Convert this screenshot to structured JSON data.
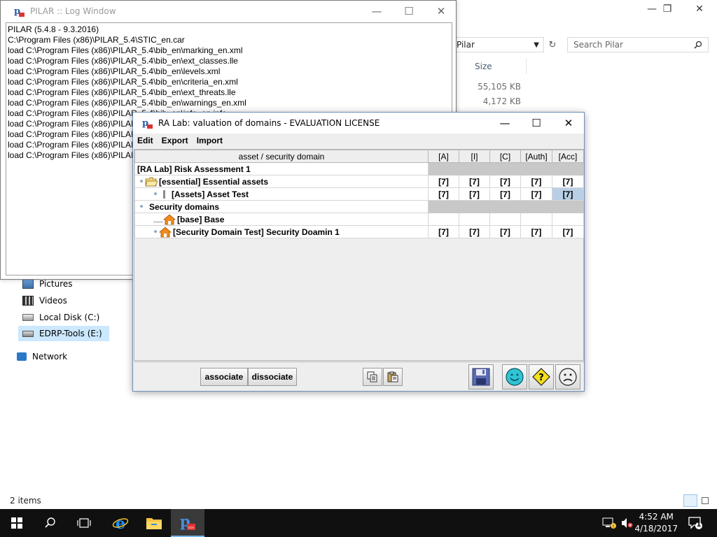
{
  "explorer": {
    "address_text": "Pilar",
    "search_placeholder": "Search Pilar",
    "column_size": "Size",
    "file_sizes": [
      "55,105 KB",
      "4,172 KB"
    ],
    "nav_items": [
      "Pictures",
      "Videos",
      "Local Disk (C:)",
      "EDRP-Tools (E:)",
      "Network"
    ],
    "status": "2 items"
  },
  "log_window": {
    "title": "PILAR :: Log Window",
    "lines": [
      "PILAR (5.4.8 - 9.3.2016)",
      "C:\\Program Files (x86)\\PILAR_5.4\\STIC_en.car",
      "load C:\\Program Files (x86)\\PILAR_5.4\\bib_en\\marking_en.xml",
      "load C:\\Program Files (x86)\\PILAR_5.4\\bib_en\\ext_classes.lle",
      "load C:\\Program Files (x86)\\PILAR_5.4\\bib_en\\levels.xml",
      "load C:\\Program Files (x86)\\PILAR_5.4\\bib_en\\criteria_en.xml",
      "load C:\\Program Files (x86)\\PILAR_5.4\\bib_en\\ext_threats.lle",
      "load C:\\Program Files (x86)\\PILAR_5.4\\bib_en\\warnings_en.xml",
      "load C:\\Program Files (x86)\\PILAR_5.4\\bib_en\\info_en.info",
      "load C:\\Program Files (x86)\\PILAR",
      "load C:\\Program Files (x86)\\PILAR",
      "load C:\\Program Files (x86)\\PILAR",
      "load C:\\Program Files (x86)\\PILAR"
    ]
  },
  "ra_window": {
    "title": "RA Lab: valuation of domains - EVALUATION LICENSE",
    "menu": [
      "Edit",
      "Export",
      "Import"
    ],
    "columns": [
      "asset / security domain",
      "[A]",
      "[I]",
      "[C]",
      "[Auth]",
      "[Acc]"
    ],
    "rows": [
      {
        "label": "[RA Lab] Risk Assessment 1",
        "values": [
          "",
          "",
          "",
          "",
          ""
        ]
      },
      {
        "label": "[essential] Essential assets",
        "values": [
          "[7]",
          "[7]",
          "[7]",
          "[7]",
          "[7]"
        ]
      },
      {
        "label": "[Assets] Asset Test",
        "values": [
          "[7]",
          "[7]",
          "[7]",
          "[7]",
          "[7]"
        ]
      },
      {
        "label": "Security domains",
        "values": [
          "",
          "",
          "",
          "",
          ""
        ]
      },
      {
        "label": "[base] Base",
        "values": [
          "",
          "",
          "",
          "",
          ""
        ]
      },
      {
        "label": "[Security Domain Test] Security Doamin 1",
        "values": [
          "[7]",
          "[7]",
          "[7]",
          "[7]",
          "[7]"
        ]
      }
    ],
    "buttons": {
      "associate": "associate",
      "dissociate": "dissociate"
    }
  },
  "taskbar": {
    "time": "4:52 AM",
    "date": "4/18/2017",
    "notification_count": "1"
  }
}
